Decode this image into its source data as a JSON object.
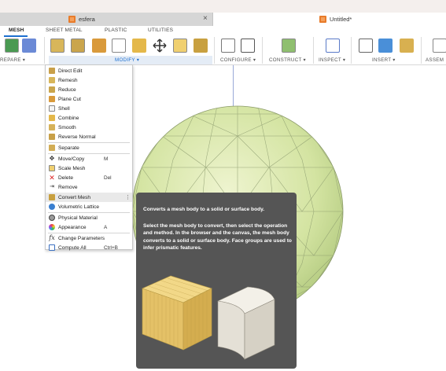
{
  "tabs": {
    "inactive": {
      "label": "esfera",
      "close": "×"
    },
    "active": {
      "label": "Untitled*"
    }
  },
  "ribbon": {
    "tabs": [
      "MESH",
      "SHEET METAL",
      "PLASTIC",
      "UTILITIES"
    ],
    "active_tab": "MESH",
    "groups": {
      "prepare": "REPARE ▾",
      "modify": "MODIFY ▾",
      "configure": "CONFIGURE ▾",
      "construct": "CONSTRUCT ▾",
      "inspect": "INSPECT ▾",
      "insert": "INSERT ▾",
      "assemble": "ASSEM"
    }
  },
  "menu": {
    "items": [
      {
        "label": "Direct Edit",
        "key": "",
        "icon": "direct-edit-icon"
      },
      {
        "label": "Remesh",
        "key": "",
        "icon": "remesh-icon"
      },
      {
        "label": "Reduce",
        "key": "",
        "icon": "reduce-icon"
      },
      {
        "label": "Plane Cut",
        "key": "",
        "icon": "plane-cut-icon"
      },
      {
        "label": "Shell",
        "key": "",
        "icon": "shell-icon"
      },
      {
        "label": "Combine",
        "key": "",
        "icon": "combine-icon"
      },
      {
        "label": "Smooth",
        "key": "",
        "icon": "smooth-icon"
      },
      {
        "label": "Reverse Normal",
        "key": "",
        "icon": "reverse-normal-icon"
      },
      {
        "label": "Separate",
        "key": "",
        "icon": "separate-icon"
      },
      {
        "label": "Move/Copy",
        "key": "M",
        "icon": "move-copy-icon"
      },
      {
        "label": "Scale Mesh",
        "key": "",
        "icon": "scale-mesh-icon"
      },
      {
        "label": "Delete",
        "key": "Del",
        "icon": "delete-icon"
      },
      {
        "label": "Remove",
        "key": "",
        "icon": "remove-icon"
      },
      {
        "label": "Convert Mesh",
        "key": "",
        "icon": "convert-mesh-icon",
        "more": "⋮"
      },
      {
        "label": "Volumetric Lattice",
        "key": "",
        "icon": "volumetric-lattice-icon"
      },
      {
        "label": "Physical Material",
        "key": "",
        "icon": "physical-material-icon"
      },
      {
        "label": "Appearance",
        "key": "A",
        "icon": "appearance-icon"
      },
      {
        "label": "Change Parameters",
        "key": "",
        "icon": "change-parameters-icon"
      },
      {
        "label": "Compute All",
        "key": "Ctrl+B",
        "icon": "compute-all-icon"
      }
    ]
  },
  "tooltip": {
    "title": "Converts a mesh body to a solid or surface body.",
    "body": "Select the mesh body to convert, then select the operation and method. In the browser and the canvas, the mesh body converts to a solid or surface body. Face groups are used to infer prismatic features."
  },
  "colors": {
    "accent": "#1c6fd0",
    "sphere": "#d6e6a6",
    "tooltip_bg": "#555555",
    "mesh_block": "#e8c978",
    "solid_block": "#e2ded4"
  }
}
